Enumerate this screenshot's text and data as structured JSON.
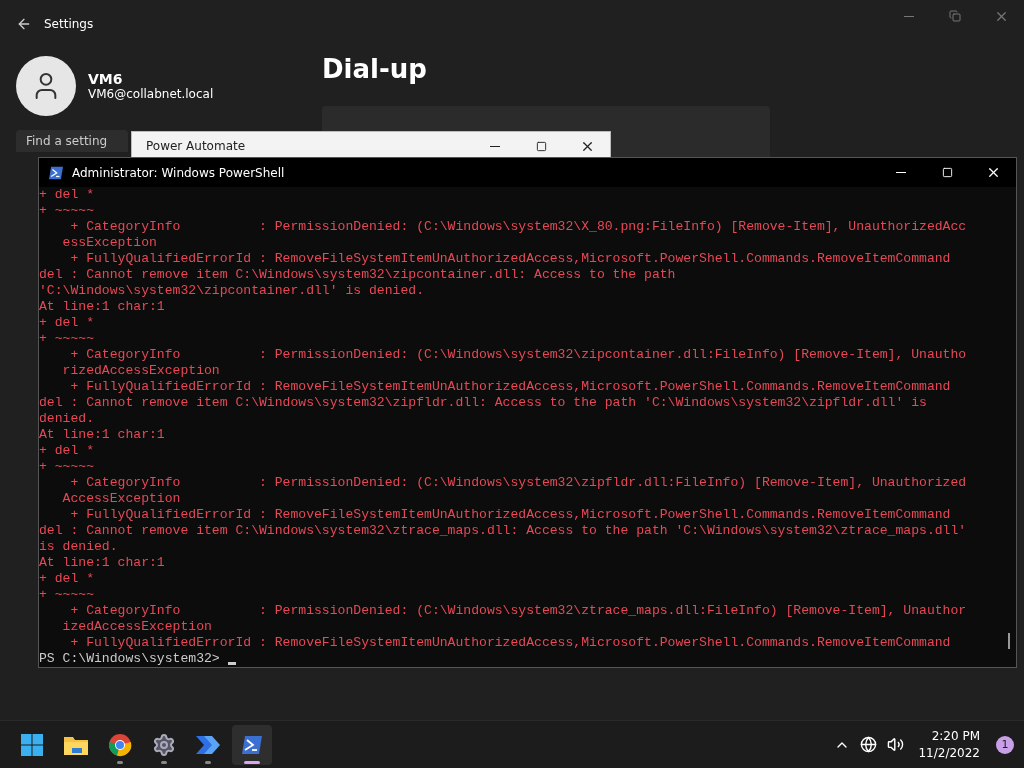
{
  "settings": {
    "title": "Settings",
    "user": {
      "name": "VM6",
      "email": "VM6@collabnet.local"
    },
    "search": {
      "placeholder": "Find a setting"
    },
    "page_title": "Dial-up"
  },
  "power_automate": {
    "title": "Power Automate"
  },
  "powershell": {
    "title": "Administrator: Windows PowerShell",
    "lines": [
      {
        "kind": "error",
        "text": "+ del *"
      },
      {
        "kind": "error",
        "text": "+ ~~~~~"
      },
      {
        "kind": "error",
        "text": "    + CategoryInfo          : PermissionDenied: (C:\\Windows\\system32\\X_80.png:FileInfo) [Remove-Item], UnauthorizedAcc"
      },
      {
        "kind": "error",
        "text": "   essException"
      },
      {
        "kind": "error",
        "text": "    + FullyQualifiedErrorId : RemoveFileSystemItemUnAuthorizedAccess,Microsoft.PowerShell.Commands.RemoveItemCommand"
      },
      {
        "kind": "error",
        "text": "del : Cannot remove item C:\\Windows\\system32\\zipcontainer.dll: Access to the path"
      },
      {
        "kind": "error",
        "text": "'C:\\Windows\\system32\\zipcontainer.dll' is denied."
      },
      {
        "kind": "error",
        "text": "At line:1 char:1"
      },
      {
        "kind": "error",
        "text": "+ del *"
      },
      {
        "kind": "error",
        "text": "+ ~~~~~"
      },
      {
        "kind": "error",
        "text": "    + CategoryInfo          : PermissionDenied: (C:\\Windows\\system32\\zipcontainer.dll:FileInfo) [Remove-Item], Unautho"
      },
      {
        "kind": "error",
        "text": "   rizedAccessException"
      },
      {
        "kind": "error",
        "text": "    + FullyQualifiedErrorId : RemoveFileSystemItemUnAuthorizedAccess,Microsoft.PowerShell.Commands.RemoveItemCommand"
      },
      {
        "kind": "error",
        "text": "del : Cannot remove item C:\\Windows\\system32\\zipfldr.dll: Access to the path 'C:\\Windows\\system32\\zipfldr.dll' is"
      },
      {
        "kind": "error",
        "text": "denied."
      },
      {
        "kind": "error",
        "text": "At line:1 char:1"
      },
      {
        "kind": "error",
        "text": "+ del *"
      },
      {
        "kind": "error",
        "text": "+ ~~~~~"
      },
      {
        "kind": "error",
        "text": "    + CategoryInfo          : PermissionDenied: (C:\\Windows\\system32\\zipfldr.dll:FileInfo) [Remove-Item], Unauthorized"
      },
      {
        "kind": "error",
        "text": "   AccessException"
      },
      {
        "kind": "error",
        "text": "    + FullyQualifiedErrorId : RemoveFileSystemItemUnAuthorizedAccess,Microsoft.PowerShell.Commands.RemoveItemCommand"
      },
      {
        "kind": "error",
        "text": "del : Cannot remove item C:\\Windows\\system32\\ztrace_maps.dll: Access to the path 'C:\\Windows\\system32\\ztrace_maps.dll'"
      },
      {
        "kind": "error",
        "text": "is denied."
      },
      {
        "kind": "error",
        "text": "At line:1 char:1"
      },
      {
        "kind": "error",
        "text": "+ del *"
      },
      {
        "kind": "error",
        "text": "+ ~~~~~"
      },
      {
        "kind": "error",
        "text": "    + CategoryInfo          : PermissionDenied: (C:\\Windows\\system32\\ztrace_maps.dll:FileInfo) [Remove-Item], Unauthor"
      },
      {
        "kind": "error",
        "text": "   izedAccessException"
      },
      {
        "kind": "error",
        "text": "    + FullyQualifiedErrorId : RemoveFileSystemItemUnAuthorizedAccess,Microsoft.PowerShell.Commands.RemoveItemCommand"
      },
      {
        "kind": "prompt",
        "text": "PS C:\\Windows\\system32> "
      }
    ]
  },
  "taskbar": {
    "apps": [
      {
        "kind": "start",
        "running": false,
        "selected": false
      },
      {
        "kind": "files",
        "running": false,
        "selected": false
      },
      {
        "kind": "browser",
        "running": true,
        "selected": false
      },
      {
        "kind": "settings",
        "running": true,
        "selected": false
      },
      {
        "kind": "automate",
        "running": true,
        "selected": false
      },
      {
        "kind": "shell",
        "running": true,
        "selected": true
      }
    ],
    "time": "2:20 PM",
    "date": "11/2/2022",
    "notifications": "1"
  }
}
